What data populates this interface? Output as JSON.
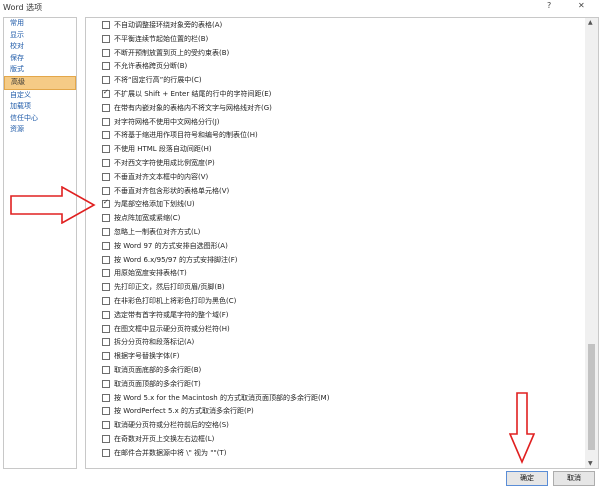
{
  "window": {
    "title": "Word 选项",
    "help_glyph": "?",
    "close_glyph": "✕"
  },
  "sidebar": {
    "items": [
      {
        "label": "常用"
      },
      {
        "label": "显示"
      },
      {
        "label": "校对"
      },
      {
        "label": "保存"
      },
      {
        "label": "版式"
      },
      {
        "label": "高级"
      },
      {
        "label": "自定义"
      },
      {
        "label": "加载项"
      },
      {
        "label": "信任中心"
      },
      {
        "label": "资源"
      }
    ],
    "active_index": 5
  },
  "options": [
    {
      "label": "不自动调整接环绕对象旁的表格(A)",
      "checked": false
    },
    {
      "label": "不平衡连续节起始位置的栏(B)",
      "checked": false
    },
    {
      "label": "不断开预制放置到页上的受约束表(B)",
      "checked": false
    },
    {
      "label": "不允许表格跨页分断(B)",
      "checked": false
    },
    {
      "label": "不将“固定行高”的行展中(C)",
      "checked": false
    },
    {
      "label": "不扩展以 Shift + Enter 结尾的行中的字符间距(E)",
      "checked": true
    },
    {
      "label": "在带有内嵌对象的表格内不将文字与网格线对齐(G)",
      "checked": false
    },
    {
      "label": "对字符网格不使用中文网格分行(J)",
      "checked": false
    },
    {
      "label": "不将基于缩进用作项目符号和编号的制表位(H)",
      "checked": false
    },
    {
      "label": "不使用 HTML 段落自动间距(H)",
      "checked": false
    },
    {
      "label": "不对西文字符使用成比例宽度(P)",
      "checked": false
    },
    {
      "label": "不垂直对齐文本框中的内容(V)",
      "checked": false
    },
    {
      "label": "不垂直对齐包含形状的表格单元格(V)",
      "checked": false
    },
    {
      "label": "为尾部空格添加下划线(U)",
      "checked": true
    },
    {
      "label": "按点阵加宽或紧缩(C)",
      "checked": false
    },
    {
      "label": "忽略上一制表位对齐方式(L)",
      "checked": false
    },
    {
      "label": "按 Word 97 的方式安排自选图形(A)",
      "checked": false
    },
    {
      "label": "按 Word 6.x/95/97 的方式安排脚注(F)",
      "checked": false
    },
    {
      "label": "用原始宽度安排表格(T)",
      "checked": false
    },
    {
      "label": "先打印正文，然后打印页眉/页脚(B)",
      "checked": false
    },
    {
      "label": "在非彩色打印机上将彩色打印为黑色(C)",
      "checked": false
    },
    {
      "label": "选定带有首字符或尾字符的整个域(F)",
      "checked": false
    },
    {
      "label": "在图文框中显示硬分页符或分栏符(H)",
      "checked": false
    },
    {
      "label": "拆分分页符和段落标记(A)",
      "checked": false
    },
    {
      "label": "根据字号替换字体(F)",
      "checked": false
    },
    {
      "label": "取消页面底部的多余行距(B)",
      "checked": false
    },
    {
      "label": "取消页面顶部的多余行距(T)",
      "checked": false
    },
    {
      "label": "按 Word 5.x for the Macintosh 的方式取消页面顶部的多余行距(M)",
      "checked": false
    },
    {
      "label": "按 WordPerfect 5.x 的方式取消多余行距(P)",
      "checked": false
    },
    {
      "label": "取消硬分页符或分栏符前后的空格(S)",
      "checked": false
    },
    {
      "label": "在奇数对开页上交换左右边框(L)",
      "checked": false
    },
    {
      "label": "在邮件合并数据源中将 \\\" 视为 \"\"(T)",
      "checked": false
    }
  ],
  "scrollbar": {
    "up_glyph": "▲",
    "down_glyph": "▼"
  },
  "buttons": {
    "ok_label": "确定",
    "cancel_label": "取消"
  },
  "colors": {
    "active_nav_bg": "#f5cb86",
    "nav_text": "#1e5aa8",
    "arrow_stroke": "#e02020"
  }
}
